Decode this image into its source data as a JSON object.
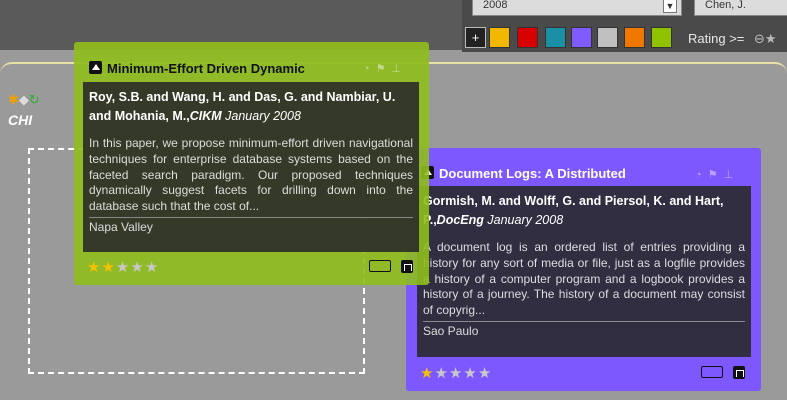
{
  "toolbar": {
    "year_value": "2008",
    "author_value": "Chen, J.",
    "add_label": "+",
    "rating_label": "Rating >=",
    "colors": [
      "#f2b800",
      "#d90000",
      "#1a8fa6",
      "#7f5cff",
      "#c0c0c0",
      "#f07800",
      "#8fc300"
    ]
  },
  "sidebar": {
    "group_label": "CHI"
  },
  "cards": [
    {
      "title": "Minimum-Effort Driven Dynamic",
      "authors": "Roy, S.B. and Wang, H. and Das, G. and Nambiar, U. and Mohania, M.,",
      "venue": "CIKM",
      "date": "January 2008",
      "abstract": "In this paper, we propose minimum-effort driven navigational techniques for enterprise database systems based on the faceted search paradigm. Our proposed techniques dynamically suggest facets for drilling down into the database such that the cost of...",
      "location": "Napa Valley",
      "rating": 2,
      "color": "#8fbe1c"
    },
    {
      "title": "Document Logs: A Distributed",
      "authors": "Gormish, M. and Wolff, G. and Piersol, K. and Hart, P.,",
      "venue": "DocEng",
      "date": "January 2008",
      "abstract": "A document log is an ordered list of entries providing a history for any sort of media or file, just as a logfile provides a history of a computer program and a logbook provides a history of a journey. The history of a document may consist of copyrig...",
      "location": "Sao Paulo",
      "rating": 1,
      "color": "#7d58ff"
    }
  ]
}
